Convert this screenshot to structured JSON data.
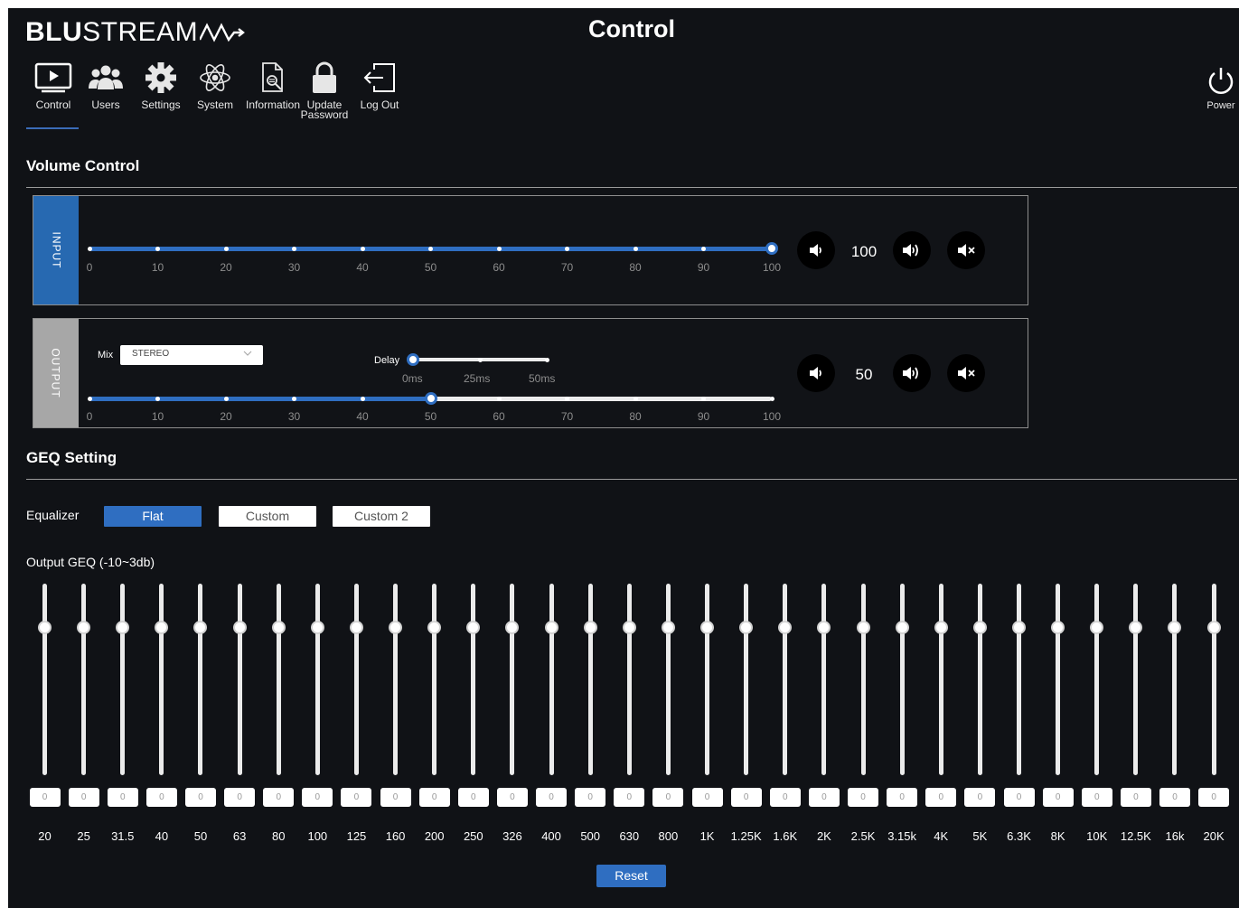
{
  "brand": {
    "logo_bold": "BLU",
    "logo_rest": "STREAM"
  },
  "page_title": "Control",
  "nav": [
    {
      "label": "Control",
      "icon": "play-screen-icon",
      "active": true
    },
    {
      "label": "Users",
      "icon": "users-icon"
    },
    {
      "label": "Settings",
      "icon": "gear-icon"
    },
    {
      "label": "System",
      "icon": "atom-icon"
    },
    {
      "label": "Information",
      "icon": "document-search-icon"
    },
    {
      "label": "Update\nPassword",
      "icon": "lock-icon"
    },
    {
      "label": "Log Out",
      "icon": "logout-icon"
    }
  ],
  "power": {
    "label": "Power"
  },
  "volume": {
    "title": "Volume Control",
    "scale": [
      "0",
      "10",
      "20",
      "30",
      "40",
      "50",
      "60",
      "70",
      "80",
      "90",
      "100"
    ],
    "input": {
      "tab": "INPUT",
      "value": 100,
      "display": "100"
    },
    "output": {
      "tab": "OUTPUT",
      "value": 50,
      "display": "50",
      "mix_label": "Mix",
      "mix_value": "STEREO",
      "delay_label": "Delay",
      "delay_value": 0,
      "delay_scale": [
        "0ms",
        "25ms",
        "50ms"
      ]
    }
  },
  "geq": {
    "title": "GEQ Setting",
    "equalizer_label": "Equalizer",
    "presets": [
      {
        "label": "Flat",
        "active": true
      },
      {
        "label": "Custom",
        "active": false
      },
      {
        "label": "Custom 2",
        "active": false
      }
    ],
    "output_label": "Output GEQ  (-10~3db)",
    "range_min": -10,
    "range_max": 3,
    "bands": [
      {
        "freq": "20",
        "value": "0"
      },
      {
        "freq": "25",
        "value": "0"
      },
      {
        "freq": "31.5",
        "value": "0"
      },
      {
        "freq": "40",
        "value": "0"
      },
      {
        "freq": "50",
        "value": "0"
      },
      {
        "freq": "63",
        "value": "0"
      },
      {
        "freq": "80",
        "value": "0"
      },
      {
        "freq": "100",
        "value": "0"
      },
      {
        "freq": "125",
        "value": "0"
      },
      {
        "freq": "160",
        "value": "0"
      },
      {
        "freq": "200",
        "value": "0"
      },
      {
        "freq": "250",
        "value": "0"
      },
      {
        "freq": "326",
        "value": "0"
      },
      {
        "freq": "400",
        "value": "0"
      },
      {
        "freq": "500",
        "value": "0"
      },
      {
        "freq": "630",
        "value": "0"
      },
      {
        "freq": "800",
        "value": "0"
      },
      {
        "freq": "1K",
        "value": "0"
      },
      {
        "freq": "1.25K",
        "value": "0"
      },
      {
        "freq": "1.6K",
        "value": "0"
      },
      {
        "freq": "2K",
        "value": "0"
      },
      {
        "freq": "2.5K",
        "value": "0"
      },
      {
        "freq": "3.15k",
        "value": "0"
      },
      {
        "freq": "4K",
        "value": "0"
      },
      {
        "freq": "5K",
        "value": "0"
      },
      {
        "freq": "6.3K",
        "value": "0"
      },
      {
        "freq": "8K",
        "value": "0"
      },
      {
        "freq": "10K",
        "value": "0"
      },
      {
        "freq": "12.5K",
        "value": "0"
      },
      {
        "freq": "16k",
        "value": "0"
      },
      {
        "freq": "20K",
        "value": "0"
      }
    ],
    "reset_label": "Reset"
  },
  "colors": {
    "accent": "#2f6ec1",
    "input_tab": "#2769b1",
    "output_tab": "#a7a7a7",
    "background": "#101216"
  }
}
